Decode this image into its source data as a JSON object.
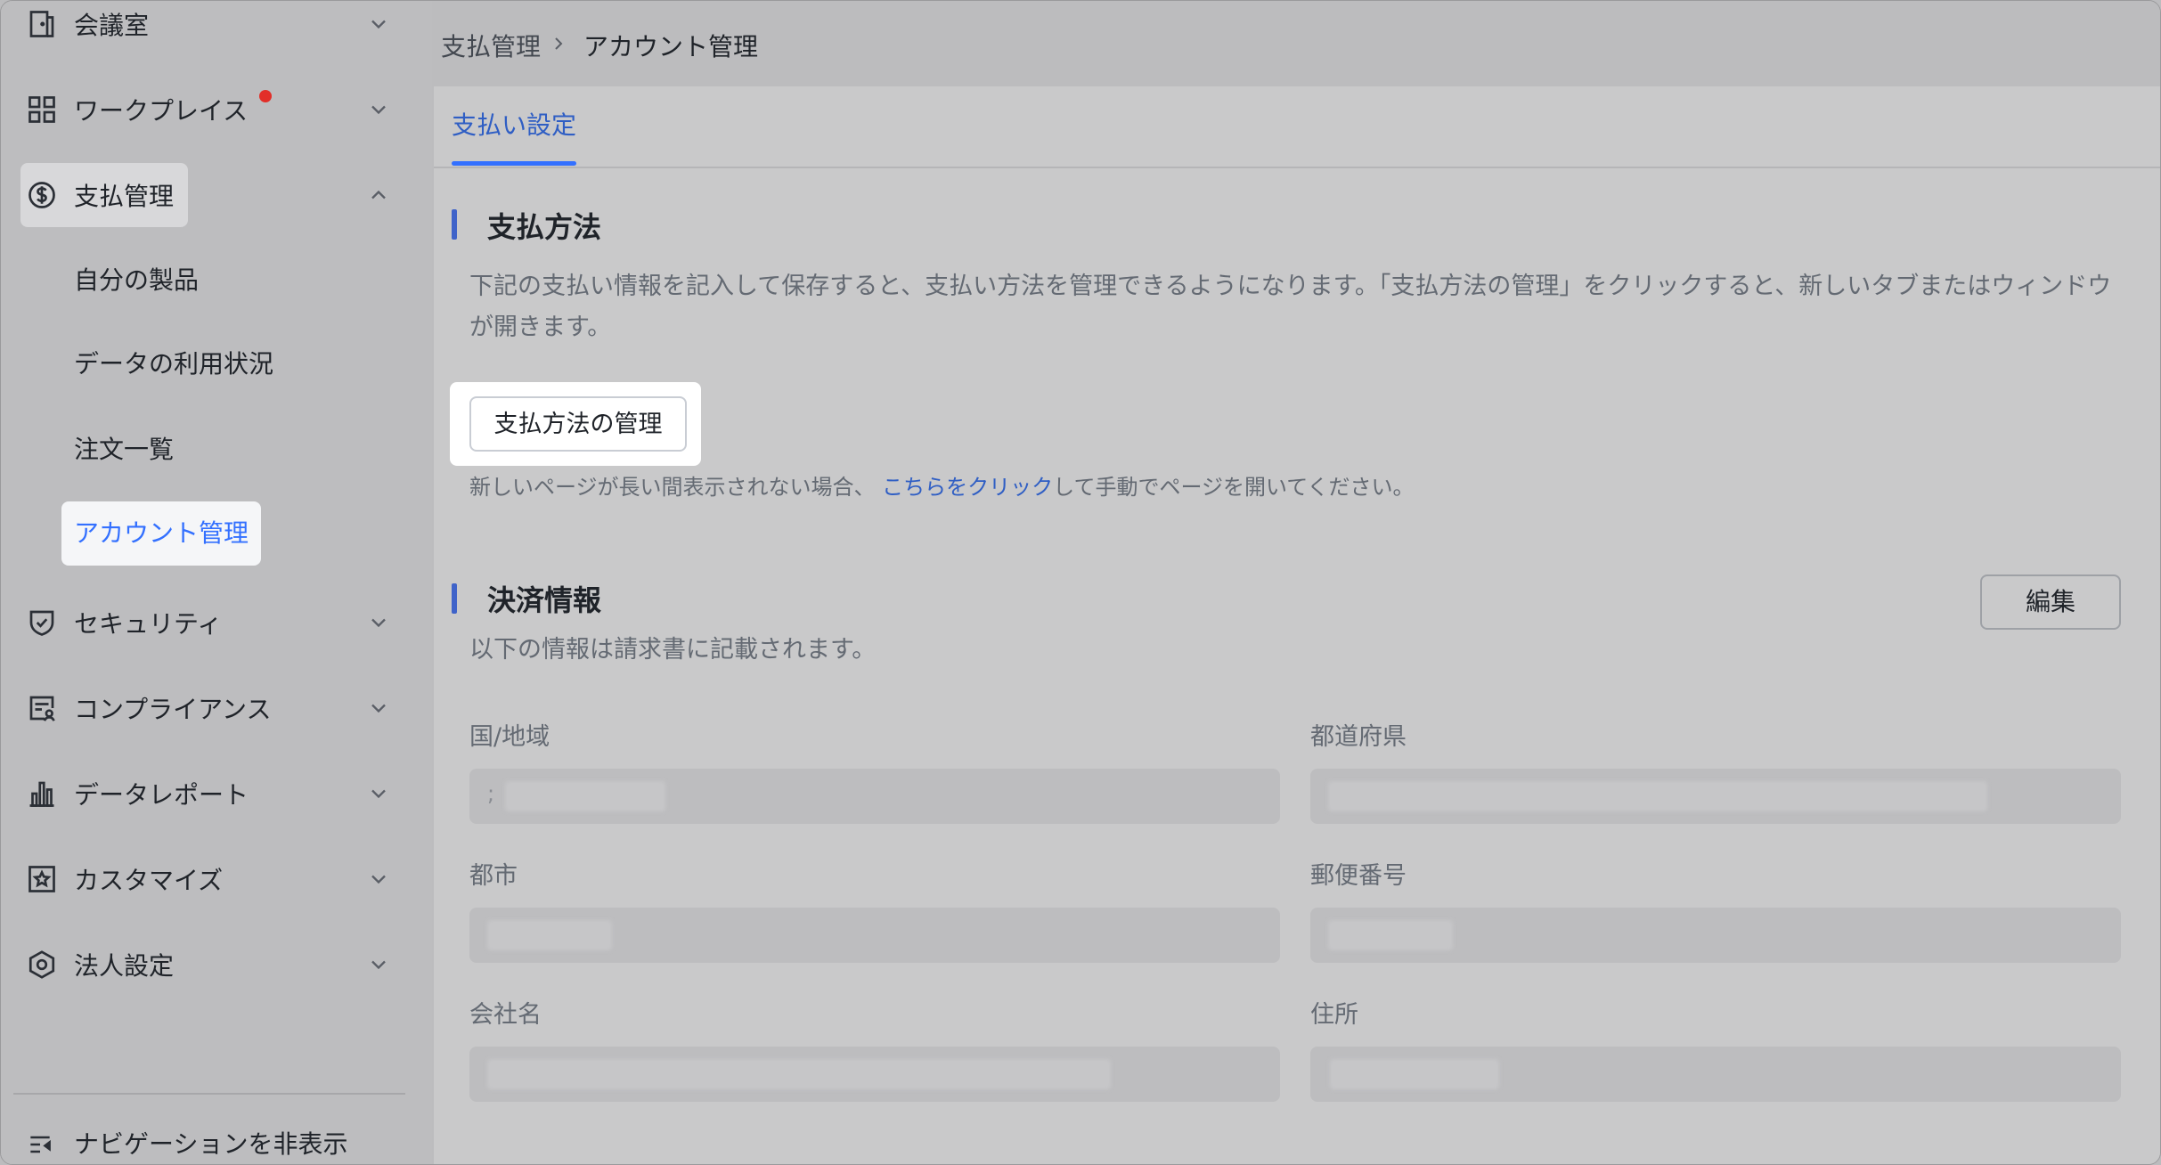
{
  "sidebar": {
    "items": [
      {
        "label": "会議室",
        "icon": "door-icon"
      },
      {
        "label": "ワークプレイス",
        "icon": "grid-icon",
        "badge_color": "#e22e28"
      },
      {
        "label": "支払管理",
        "icon": "dollar-icon",
        "expanded": true
      },
      {
        "label": "セキュリティ",
        "icon": "shield-icon"
      },
      {
        "label": "コンプライアンス",
        "icon": "compliance-icon"
      },
      {
        "label": "データレポート",
        "icon": "bar-chart-icon"
      },
      {
        "label": "カスタマイズ",
        "icon": "star-box-icon"
      },
      {
        "label": "法人設定",
        "icon": "hexagon-gear-icon"
      }
    ],
    "sub_items": [
      {
        "label": "自分の製品"
      },
      {
        "label": "データの利用状況"
      },
      {
        "label": "注文一覧"
      },
      {
        "label": "アカウント管理",
        "active": true
      }
    ],
    "hide_nav_label": "ナビゲーションを非表示"
  },
  "breadcrumb": {
    "parent": "支払管理",
    "current": "アカウント管理"
  },
  "tabs": [
    {
      "label": "支払い設定",
      "active": true
    }
  ],
  "payment_method": {
    "title": "支払方法",
    "description": "下記の支払い情報を記入して保存すると、支払い方法を管理できるようになります。「支払方法の管理」をクリックすると、新しいタブまたはウィンドウが開きます。",
    "manage_button": "支払方法の管理",
    "note_before": "新しいページが長い間表示されない場合、",
    "note_link": "こちらをクリック",
    "note_after": "して手動でページを開いてください。"
  },
  "billing_info": {
    "title": "決済情報",
    "edit_button": "編集",
    "description": "以下の情報は請求書に記載されます。",
    "fields": [
      {
        "label": "国/地域",
        "value": ";"
      },
      {
        "label": "都道府県",
        "value": ""
      },
      {
        "label": "都市",
        "value": ""
      },
      {
        "label": "郵便番号",
        "value": ""
      },
      {
        "label": "会社名",
        "value": ""
      },
      {
        "label": "住所",
        "value": ""
      }
    ]
  },
  "colors": {
    "accent": "#3370ff",
    "section_bar": "#3f63c9",
    "link": "#2f5ec4",
    "badge": "#e22e28"
  }
}
